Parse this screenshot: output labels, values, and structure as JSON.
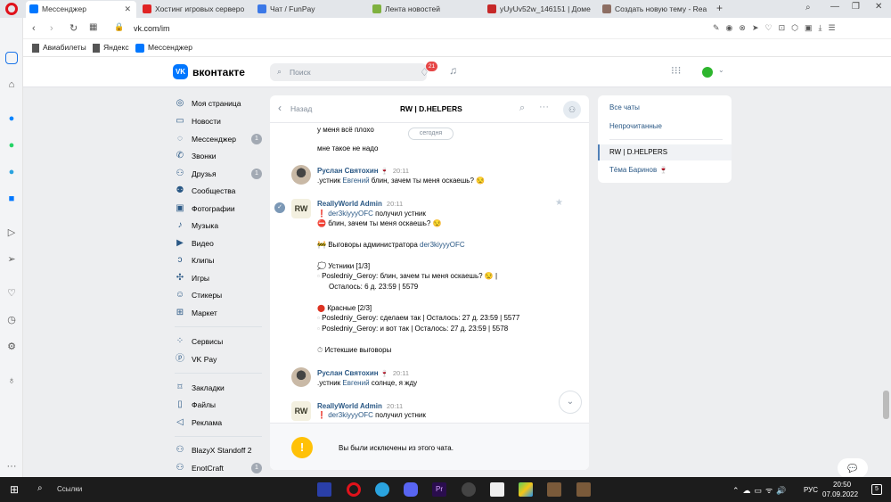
{
  "browser": {
    "tabs": [
      {
        "title": "Мессенджер",
        "color": "#0077ff"
      },
      {
        "title": "Хостинг игровых серверо",
        "color": "#e02424"
      },
      {
        "title": "Чат / FunPay",
        "color": "#3b78e7"
      },
      {
        "title": "Лента новостей",
        "color": "#7fb13f"
      },
      {
        "title": "yUyUv52w_146151 | Доме",
        "color": "#c62828"
      },
      {
        "title": "Создать новую тему - Rea",
        "color": "#8d6e63"
      }
    ],
    "url": "vk.com/im",
    "bookmarks": [
      "Авиабилеты",
      "Яндекс",
      "Мессенджер"
    ]
  },
  "vk": {
    "logo": "вконтакте",
    "search_placeholder": "Поиск",
    "notif_count": "21",
    "left_menu": [
      {
        "label": "Моя страница",
        "icon": "user-icon",
        "count": ""
      },
      {
        "label": "Новости",
        "icon": "news-icon",
        "count": ""
      },
      {
        "label": "Мессенджер",
        "icon": "message-icon",
        "count": "1"
      },
      {
        "label": "Звонки",
        "icon": "phone-icon",
        "count": ""
      },
      {
        "label": "Друзья",
        "icon": "friends-icon",
        "count": "1"
      },
      {
        "label": "Сообщества",
        "icon": "community-icon",
        "count": ""
      },
      {
        "label": "Фотографии",
        "icon": "photo-icon",
        "count": ""
      },
      {
        "label": "Музыка",
        "icon": "music-icon",
        "count": ""
      },
      {
        "label": "Видео",
        "icon": "video-icon",
        "count": ""
      },
      {
        "label": "Клипы",
        "icon": "clips-icon",
        "count": ""
      },
      {
        "label": "Игры",
        "icon": "games-icon",
        "count": ""
      },
      {
        "label": "Стикеры",
        "icon": "stickers-icon",
        "count": ""
      },
      {
        "label": "Маркет",
        "icon": "market-icon",
        "count": ""
      },
      {
        "label": "Сервисы",
        "icon": "services-icon",
        "count": ""
      },
      {
        "label": "VK Pay",
        "icon": "vkpay-icon",
        "count": ""
      },
      {
        "label": "Закладки",
        "icon": "bookmark-icon",
        "count": ""
      },
      {
        "label": "Файлы",
        "icon": "file-icon",
        "count": ""
      },
      {
        "label": "Реклама",
        "icon": "ads-icon",
        "count": ""
      },
      {
        "label": "BlazyX Standoff 2",
        "icon": "group-icon",
        "count": ""
      },
      {
        "label": "EnotCraft",
        "icon": "group-icon",
        "count": "1"
      }
    ],
    "chat": {
      "back": "Назад",
      "title": "RW | D.HELPERS",
      "date_badge": "сегодня",
      "pre_lines": [
        "у меня всё плохо",
        "мне такое не надо"
      ],
      "msg1": {
        "author": "Руслан Святохин",
        "time": "20:11",
        "prefix": ".устник ",
        "link": "Евгений",
        "suffix": " блин, зачем ты меня оскаешь? 😒"
      },
      "msg2": {
        "author": "ReallyWorld Admin",
        "time": "20:11",
        "l1_link": "der3kiyyyOFC",
        "l1_text": " получил устник",
        "l2": "блин, зачем ты меня оскаешь? 😒",
        "l3_text": "Выговоры администратора ",
        "l3_link": "der3kiyyyOFC",
        "l4": "Устники [1/3]",
        "l5": "Posledniy_Geroy: блин, зачем ты меня оскаешь? 😒 |",
        "l6": "Осталось: 6 д. 23:59 | 5579",
        "l7": "Красные [2/3]",
        "l8": "Posledniy_Geroy: сделаем так | Осталось: 27 д. 23:59 | 5577",
        "l9": "Posledniy_Geroy: и вот так | Осталось: 27 д. 23:59 | 5578",
        "l10": "Истекшие выговоры"
      },
      "msg3": {
        "author": "Руслан Святохин",
        "time": "20:11",
        "prefix": ".устник ",
        "link": "Евгений",
        "suffix": " солнце, я жду"
      },
      "msg4": {
        "author": "ReallyWorld Admin",
        "time": "20:11",
        "l1_link": "der3kiyyyOFC",
        "l1_text": " получил устник"
      },
      "excluded": "Вы были исключены из этого чата."
    },
    "right_panel": {
      "all": "Все чаты",
      "unread": "Непрочитанные",
      "active": "RW | D.HELPERS",
      "other": "Тёма Баринов 🍷"
    }
  },
  "taskbar": {
    "search": "Ссылки",
    "time": "20:50",
    "date": "07.09.2022",
    "lang": "РУС",
    "notif": "5"
  }
}
